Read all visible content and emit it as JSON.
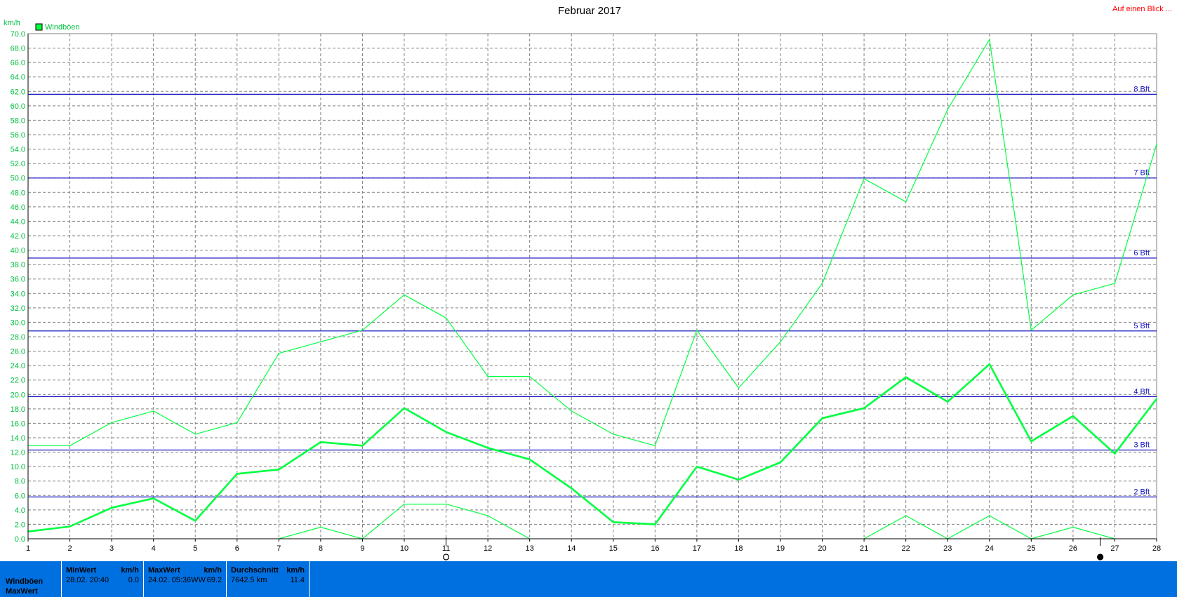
{
  "header": {
    "title": "Februar 2017",
    "link_label": "Auf einen Blick ..."
  },
  "chart_data": {
    "type": "line",
    "title": "Februar 2017",
    "ylabel": "km/h",
    "ylim": [
      0,
      70
    ],
    "ytick_step": 2,
    "xlim": [
      1,
      28
    ],
    "x_ticks": [
      1,
      2,
      3,
      4,
      5,
      6,
      7,
      8,
      9,
      10,
      11,
      12,
      13,
      14,
      15,
      16,
      17,
      18,
      19,
      20,
      21,
      22,
      23,
      24,
      25,
      26,
      27,
      28
    ],
    "grid": true,
    "legend": {
      "position": "top-left",
      "entries": [
        "Windböen"
      ]
    },
    "series": [
      {
        "name": "Windböen",
        "role": "max",
        "color": "#00ff40",
        "x": [
          1,
          2,
          3,
          4,
          5,
          6,
          7,
          8,
          9,
          10,
          11,
          12,
          13,
          14,
          15,
          16,
          17,
          18,
          19,
          20,
          21,
          22,
          23,
          24,
          25,
          26,
          27,
          28
        ],
        "values": [
          12.9,
          12.9,
          16.1,
          17.7,
          14.5,
          16.1,
          25.7,
          27.3,
          28.9,
          33.8,
          30.6,
          22.5,
          22.5,
          17.7,
          14.5,
          12.9,
          28.9,
          20.9,
          27.3,
          35.4,
          49.9,
          46.7,
          59.5,
          69.2,
          28.9,
          33.8,
          35.4,
          54.7
        ]
      },
      {
        "name": "",
        "role": "average",
        "color": "#00ff40",
        "x": [
          1,
          2,
          3,
          4,
          5,
          6,
          7,
          8,
          9,
          10,
          11,
          12,
          13,
          14,
          15,
          16,
          17,
          18,
          19,
          20,
          21,
          22,
          23,
          24,
          25,
          26,
          27,
          28
        ],
        "values": [
          1.0,
          1.7,
          4.3,
          5.6,
          2.5,
          9.0,
          9.6,
          13.4,
          12.9,
          18.1,
          14.8,
          12.6,
          11.0,
          7.0,
          2.3,
          2.0,
          10.0,
          8.2,
          10.6,
          16.7,
          18.1,
          22.4,
          19.0,
          24.2,
          13.5,
          17.0,
          11.8,
          19.4
        ]
      },
      {
        "name": "",
        "role": "min",
        "color": "#00ff40",
        "x": [
          7,
          8,
          9,
          10,
          11,
          12,
          13
        ],
        "values": [
          0.0,
          1.6,
          0.0,
          4.8,
          4.8,
          3.2,
          0.0
        ]
      },
      {
        "name": "",
        "role": "min",
        "color": "#00ff40",
        "x": [
          21,
          22,
          23,
          24,
          25,
          26,
          27
        ],
        "values": [
          0.0,
          3.2,
          0.0,
          3.2,
          0.0,
          1.6,
          0.0
        ]
      }
    ],
    "beaufort_lines": [
      {
        "label": "2 Bft",
        "value": 5.8
      },
      {
        "label": "3 Bft",
        "value": 12.3
      },
      {
        "label": "4 Bft",
        "value": 19.7
      },
      {
        "label": "5 Bft",
        "value": 28.8
      },
      {
        "label": "6 Bft",
        "value": 38.9
      },
      {
        "label": "7 Bft",
        "value": 50.0
      },
      {
        "label": "8 Bft",
        "value": 61.6
      }
    ],
    "beaufort_color": "#1010c0",
    "markers": [
      {
        "x": 11,
        "icon": "empty-circle-icon"
      },
      {
        "x": 26.65,
        "icon": "filled-circle-icon"
      }
    ]
  },
  "stats": {
    "row_labels": [
      "Windböen",
      "MaxWert"
    ],
    "boxes": [
      {
        "title": "MinWert",
        "unit": "km/h",
        "left": "28.02.  20:40",
        "right": "0.0"
      },
      {
        "title": "MaxWert",
        "unit": "km/h",
        "left": "24.02.  05:36WW",
        "right": "69.2"
      },
      {
        "title": "Durchschnitt",
        "unit": "km/h",
        "left": "7642.5 km",
        "right": "11.4"
      }
    ]
  }
}
